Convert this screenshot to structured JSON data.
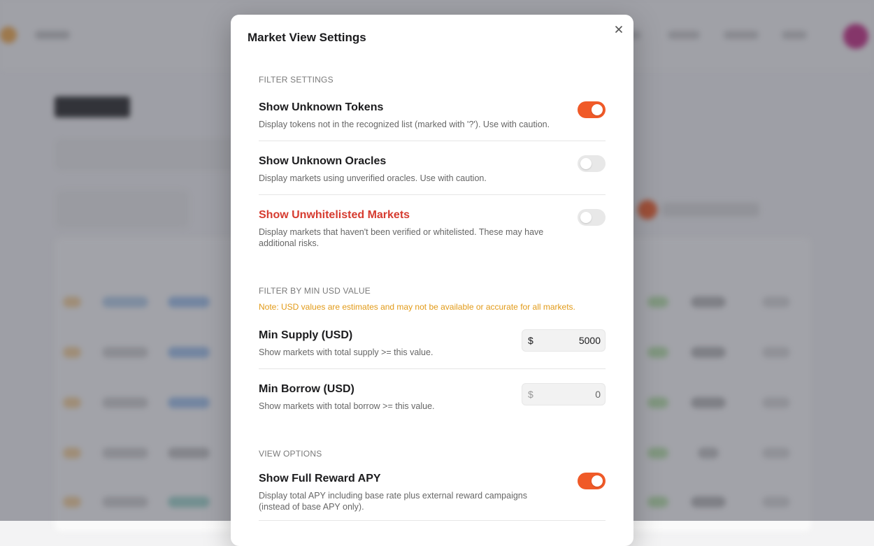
{
  "modal": {
    "title": "Market View Settings",
    "close_icon": "close-icon"
  },
  "filter_settings": {
    "label": "FILTER SETTINGS",
    "items": [
      {
        "title": "Show Unknown Tokens",
        "description": "Display tokens not in the recognized list (marked with '?'). Use with caution.",
        "enabled": true
      },
      {
        "title": "Show Unknown Oracles",
        "description": "Display markets using unverified oracles. Use with caution.",
        "enabled": false
      },
      {
        "title": "Show Unwhitelisted Markets",
        "description": "Display markets that haven't been verified or whitelisted. These may have additional risks.",
        "enabled": false,
        "color": "#d63b2f"
      }
    ]
  },
  "min_usd": {
    "label": "FILTER BY MIN USD VALUE",
    "note": "Note: USD values are estimates and may not be available or accurate for all markets.",
    "note_color": "#e29a17",
    "currency_symbol": "$",
    "supply": {
      "title": "Min Supply (USD)",
      "description": "Show markets with total supply >= this value.",
      "value": "5000"
    },
    "borrow": {
      "title": "Min Borrow (USD)",
      "description": "Show markets with total borrow >= this value.",
      "value": "0"
    }
  },
  "view_options": {
    "label": "VIEW OPTIONS",
    "items": [
      {
        "title": "Show Full Reward APY",
        "description": "Display total APY including base rate plus external reward campaigns (instead of base APY only).",
        "enabled": true
      }
    ]
  },
  "colors": {
    "accent": "#f05a28",
    "toggle_off": "#e8e8e8",
    "danger": "#d63b2f",
    "warning": "#e29a17"
  }
}
